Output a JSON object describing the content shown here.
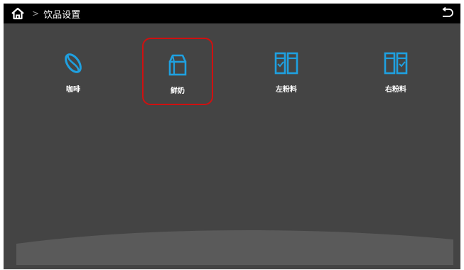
{
  "header": {
    "separator": ">",
    "title": "饮品设置"
  },
  "tiles": [
    {
      "label": "咖啡",
      "icon": "coffee-bean-icon",
      "selected": false
    },
    {
      "label": "鲜奶",
      "icon": "milk-carton-icon",
      "selected": true
    },
    {
      "label": "左粉料",
      "icon": "powder-box-left-icon",
      "selected": false
    },
    {
      "label": "右粉料",
      "icon": "powder-box-right-icon",
      "selected": false
    }
  ],
  "colors": {
    "accent": "#1fa0e0",
    "selection": "#d01010",
    "background": "#444444",
    "topbar": "#000000"
  }
}
